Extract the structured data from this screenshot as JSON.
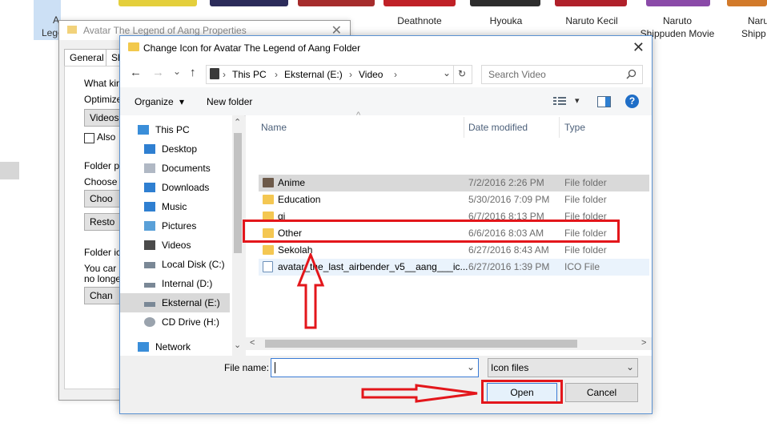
{
  "background": {
    "left_label_line1": "A",
    "left_label_line2": "Lege",
    "thumbnails": [
      {
        "label": "Deathnote",
        "label2": "",
        "color": "#b0202a"
      },
      {
        "label": "Hyouka",
        "label2": "",
        "color": "#8a4aa8"
      },
      {
        "label": "Naruto Kecil",
        "label2": "",
        "color": "#d27a2a"
      },
      {
        "label": "Naruto",
        "label2": "Shippuden Movie",
        "color": "#8f8f8f"
      },
      {
        "label": "Naru",
        "label2": "Shipp",
        "color": "#3b7bc4"
      }
    ],
    "partial_thumb_colors": [
      "#e4cf3c",
      "#2b2b5a",
      "#a62c2c",
      "#c02127",
      "#2d2d2d"
    ]
  },
  "properties_window": {
    "title": "Avatar The Legend of Aang Properties",
    "close_glyph": "✕",
    "tabs": [
      "General",
      "Sh"
    ],
    "texts": {
      "what_kind": "What kind",
      "optimize": "Optimize t",
      "videos_btn": "Videos",
      "also": "Also",
      "folder_pictures": "Folder p",
      "choose": "Choose",
      "choose_btn": "Choo",
      "restore_btn": "Resto",
      "folder_icons": "Folder ic",
      "you_can": "You car",
      "no_longer": "no longe",
      "change_btn": "Chan"
    }
  },
  "dialog": {
    "title": "Change Icon for Avatar The Legend of Aang Folder",
    "close_glyph": "✕",
    "nav": {
      "back": "←",
      "forward": "→",
      "dropdown": "⌄",
      "up": "↑"
    },
    "address": {
      "segments": [
        "This PC",
        "Eksternal (E:)",
        "Video"
      ],
      "sep": "›",
      "dropdown": "⌄",
      "refresh": "↻"
    },
    "search": {
      "placeholder": "Search Video"
    },
    "toolbar": {
      "organize": "Organize",
      "organize_arrow": "▾",
      "new_folder": "New folder",
      "view_arrow": "▾",
      "help": "?"
    },
    "nav_pane": [
      {
        "label": "This PC",
        "icon": "pc-icon",
        "color": "#3a8ed9"
      },
      {
        "label": "Desktop",
        "icon": "desktop-icon",
        "color": "#2f7fd1"
      },
      {
        "label": "Documents",
        "icon": "documents-icon",
        "color": "#b0b8c4"
      },
      {
        "label": "Downloads",
        "icon": "downloads-icon",
        "color": "#2f7fd1"
      },
      {
        "label": "Music",
        "icon": "music-icon",
        "color": "#2f7fd1"
      },
      {
        "label": "Pictures",
        "icon": "pictures-icon",
        "color": "#5aa0d8"
      },
      {
        "label": "Videos",
        "icon": "videos-icon",
        "color": "#4a4a4a"
      },
      {
        "label": "Local Disk (C:)",
        "icon": "disk-icon",
        "color": "#7a8896"
      },
      {
        "label": "Internal (D:)",
        "icon": "disk-icon",
        "color": "#7a8896"
      },
      {
        "label": "Eksternal (E:)",
        "icon": "disk-icon",
        "color": "#7a8896"
      },
      {
        "label": "CD Drive (H:)",
        "icon": "cd-icon",
        "color": "#9aa3ad"
      },
      {
        "label": "Network",
        "icon": "network-icon",
        "color": "#3a8ed9"
      }
    ],
    "selected_nav_index": 9,
    "columns": {
      "name": "Name",
      "date": "Date modified",
      "type": "Type",
      "sort_arrow": "^"
    },
    "files": [
      {
        "name": "Anime",
        "date": "7/2/2016 2:26 PM",
        "type": "File folder",
        "kind": "folder-thumb"
      },
      {
        "name": "Education",
        "date": "5/30/2016 7:09 PM",
        "type": "File folder",
        "kind": "folder"
      },
      {
        "name": "gj",
        "date": "6/7/2016 8:13 PM",
        "type": "File folder",
        "kind": "folder"
      },
      {
        "name": "Other",
        "date": "6/6/2016 8:03 AM",
        "type": "File folder",
        "kind": "folder"
      },
      {
        "name": "Sekolah",
        "date": "6/27/2016 8:43 AM",
        "type": "File folder",
        "kind": "folder"
      },
      {
        "name": "avatar_the_last_airbender_v5__aang___ic...",
        "date": "6/27/2016 1:39 PM",
        "type": "ICO File",
        "kind": "ico"
      }
    ],
    "scroll": {
      "up": "⌃",
      "down": "⌄",
      "left": "<",
      "right": ">"
    },
    "bottom": {
      "file_name_label": "File name:",
      "file_name_value": "",
      "file_name_dropdown": "⌄",
      "filter_value": "Icon files",
      "filter_dropdown": "⌄",
      "open_label": "Open",
      "cancel_label": "Cancel"
    }
  },
  "annotations": {
    "color": "#e3161b"
  }
}
